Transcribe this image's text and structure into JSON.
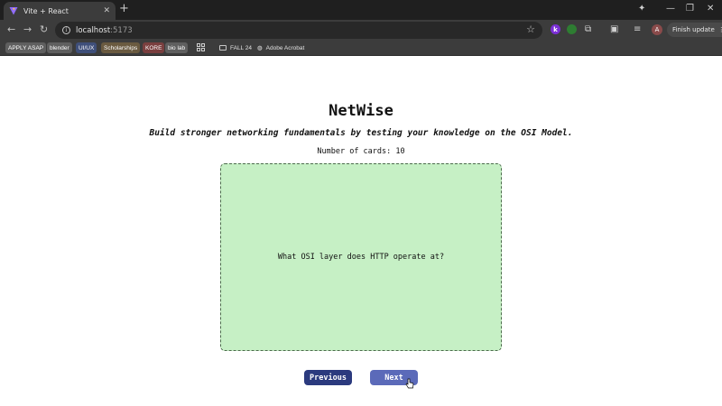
{
  "browser": {
    "tab": {
      "title": "Vite + React",
      "favicon": "vite-icon"
    },
    "address": {
      "host": "localhost",
      "port": ":5173"
    },
    "extensions": [
      {
        "letter": "k",
        "color": "#7b2fd6"
      },
      {
        "letter": "",
        "color": "#2e7d32"
      }
    ],
    "profile_initial": "A",
    "finish_update_label": "Finish update",
    "bookmarks": {
      "chips": [
        {
          "label": "APPLY ASAP",
          "color": "#5f5f5f"
        },
        {
          "label": "blender",
          "color": "#5f5f5f"
        },
        {
          "label": "UI/UX",
          "color": "#3f4f7a"
        },
        {
          "label": "Scholarships",
          "color": "#6a5a40"
        },
        {
          "label": "KORE",
          "color": "#7a3f3f"
        },
        {
          "label": "bio lab",
          "color": "#5f5f5f"
        }
      ],
      "folder": "FALL 24",
      "acrobat": "Adobe Acrobat"
    }
  },
  "app": {
    "title": "NetWise",
    "subtitle": "Build stronger networking fundamentals by testing your knowledge on the OSI Model.",
    "card_count_label": "Number of cards: 10",
    "card": {
      "text": "What OSI layer does HTTP operate at?",
      "color": "#c6f0c5"
    },
    "buttons": {
      "previous": "Previous",
      "next": "Next"
    }
  }
}
